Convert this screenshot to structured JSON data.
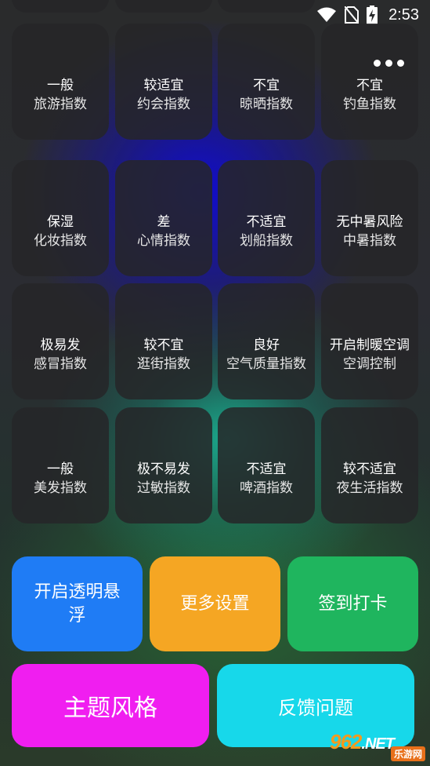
{
  "status_bar": {
    "time": "2:53",
    "icons": [
      "wifi-icon",
      "no-sim-icon",
      "battery-charging-icon"
    ]
  },
  "tiles": [
    [
      {
        "value": "一般",
        "label": "旅游指数"
      },
      {
        "value": "较适宜",
        "label": "约会指数"
      },
      {
        "value": "不宜",
        "label": "晾晒指数"
      },
      {
        "value": "不宜",
        "label": "钓鱼指数"
      }
    ],
    [
      {
        "value": "保湿",
        "label": "化妆指数"
      },
      {
        "value": "差",
        "label": "心情指数"
      },
      {
        "value": "不适宜",
        "label": "划船指数"
      },
      {
        "value": "无中暑风险",
        "label": "中暑指数"
      }
    ],
    [
      {
        "value": "极易发",
        "label": "感冒指数"
      },
      {
        "value": "较不宜",
        "label": "逛街指数"
      },
      {
        "value": "良好",
        "label": "空气质量指数"
      },
      {
        "value": "开启制暖空调",
        "label": "空调控制"
      }
    ],
    [
      {
        "value": "一般",
        "label": "美发指数"
      },
      {
        "value": "极不易发",
        "label": "过敏指数"
      },
      {
        "value": "不适宜",
        "label": "啤酒指数"
      },
      {
        "value": "较不适宜",
        "label": "夜生活指数"
      }
    ]
  ],
  "buttons": {
    "transparent_float": {
      "label": "开启透明悬浮",
      "color": "#1f7cf5"
    },
    "more_settings": {
      "label": "更多设置",
      "color": "#f5a623"
    },
    "check_in": {
      "label": "签到打卡",
      "color": "#1fb55e"
    },
    "theme_style": {
      "label": "主题风格",
      "color": "#f01ef0"
    },
    "feedback": {
      "label": "反馈问题",
      "color": "#17d8ea"
    }
  },
  "watermark": {
    "main": "962",
    "suffix": ".NET",
    "sub": "乐游网"
  }
}
